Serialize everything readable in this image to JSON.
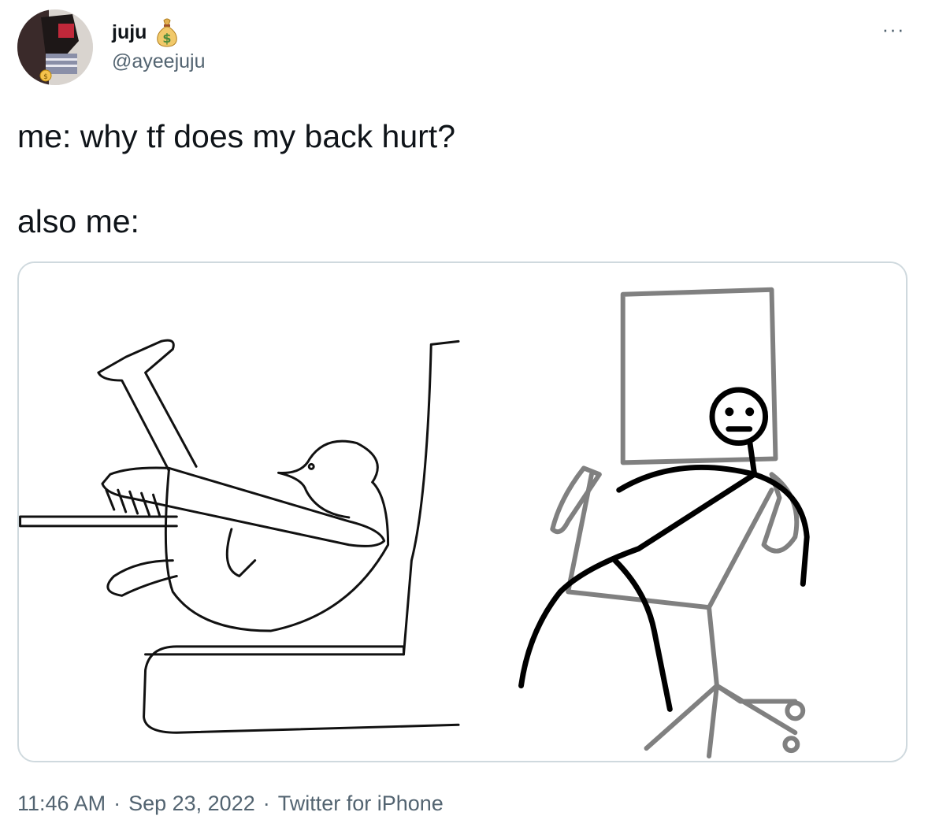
{
  "tweet": {
    "display_name": "juju",
    "name_badge_icon": "money-bag-icon",
    "handle": "@ayeejuju",
    "more_icon": "more-options-icon",
    "more_glyph": "···",
    "text": "me: why tf does my back hurt?\n\nalso me:",
    "time": "11:46 AM",
    "separator": "·",
    "date": "Sep 23, 2022",
    "source": "Twitter for iPhone"
  },
  "colors": {
    "text": "#0f1419",
    "secondary": "#536471",
    "border": "#cfd9de"
  }
}
